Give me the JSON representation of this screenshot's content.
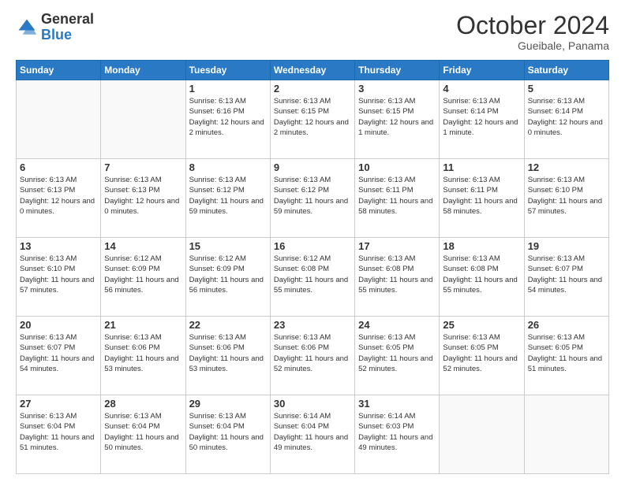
{
  "logo": {
    "general": "General",
    "blue": "Blue"
  },
  "header": {
    "month": "October 2024",
    "location": "Gueibale, Panama"
  },
  "weekdays": [
    "Sunday",
    "Monday",
    "Tuesday",
    "Wednesday",
    "Thursday",
    "Friday",
    "Saturday"
  ],
  "weeks": [
    [
      {
        "day": "",
        "info": ""
      },
      {
        "day": "",
        "info": ""
      },
      {
        "day": "1",
        "info": "Sunrise: 6:13 AM\nSunset: 6:16 PM\nDaylight: 12 hours and 2 minutes."
      },
      {
        "day": "2",
        "info": "Sunrise: 6:13 AM\nSunset: 6:15 PM\nDaylight: 12 hours and 2 minutes."
      },
      {
        "day": "3",
        "info": "Sunrise: 6:13 AM\nSunset: 6:15 PM\nDaylight: 12 hours and 1 minute."
      },
      {
        "day": "4",
        "info": "Sunrise: 6:13 AM\nSunset: 6:14 PM\nDaylight: 12 hours and 1 minute."
      },
      {
        "day": "5",
        "info": "Sunrise: 6:13 AM\nSunset: 6:14 PM\nDaylight: 12 hours and 0 minutes."
      }
    ],
    [
      {
        "day": "6",
        "info": "Sunrise: 6:13 AM\nSunset: 6:13 PM\nDaylight: 12 hours and 0 minutes."
      },
      {
        "day": "7",
        "info": "Sunrise: 6:13 AM\nSunset: 6:13 PM\nDaylight: 12 hours and 0 minutes."
      },
      {
        "day": "8",
        "info": "Sunrise: 6:13 AM\nSunset: 6:12 PM\nDaylight: 11 hours and 59 minutes."
      },
      {
        "day": "9",
        "info": "Sunrise: 6:13 AM\nSunset: 6:12 PM\nDaylight: 11 hours and 59 minutes."
      },
      {
        "day": "10",
        "info": "Sunrise: 6:13 AM\nSunset: 6:11 PM\nDaylight: 11 hours and 58 minutes."
      },
      {
        "day": "11",
        "info": "Sunrise: 6:13 AM\nSunset: 6:11 PM\nDaylight: 11 hours and 58 minutes."
      },
      {
        "day": "12",
        "info": "Sunrise: 6:13 AM\nSunset: 6:10 PM\nDaylight: 11 hours and 57 minutes."
      }
    ],
    [
      {
        "day": "13",
        "info": "Sunrise: 6:13 AM\nSunset: 6:10 PM\nDaylight: 11 hours and 57 minutes."
      },
      {
        "day": "14",
        "info": "Sunrise: 6:12 AM\nSunset: 6:09 PM\nDaylight: 11 hours and 56 minutes."
      },
      {
        "day": "15",
        "info": "Sunrise: 6:12 AM\nSunset: 6:09 PM\nDaylight: 11 hours and 56 minutes."
      },
      {
        "day": "16",
        "info": "Sunrise: 6:12 AM\nSunset: 6:08 PM\nDaylight: 11 hours and 55 minutes."
      },
      {
        "day": "17",
        "info": "Sunrise: 6:13 AM\nSunset: 6:08 PM\nDaylight: 11 hours and 55 minutes."
      },
      {
        "day": "18",
        "info": "Sunrise: 6:13 AM\nSunset: 6:08 PM\nDaylight: 11 hours and 55 minutes."
      },
      {
        "day": "19",
        "info": "Sunrise: 6:13 AM\nSunset: 6:07 PM\nDaylight: 11 hours and 54 minutes."
      }
    ],
    [
      {
        "day": "20",
        "info": "Sunrise: 6:13 AM\nSunset: 6:07 PM\nDaylight: 11 hours and 54 minutes."
      },
      {
        "day": "21",
        "info": "Sunrise: 6:13 AM\nSunset: 6:06 PM\nDaylight: 11 hours and 53 minutes."
      },
      {
        "day": "22",
        "info": "Sunrise: 6:13 AM\nSunset: 6:06 PM\nDaylight: 11 hours and 53 minutes."
      },
      {
        "day": "23",
        "info": "Sunrise: 6:13 AM\nSunset: 6:06 PM\nDaylight: 11 hours and 52 minutes."
      },
      {
        "day": "24",
        "info": "Sunrise: 6:13 AM\nSunset: 6:05 PM\nDaylight: 11 hours and 52 minutes."
      },
      {
        "day": "25",
        "info": "Sunrise: 6:13 AM\nSunset: 6:05 PM\nDaylight: 11 hours and 52 minutes."
      },
      {
        "day": "26",
        "info": "Sunrise: 6:13 AM\nSunset: 6:05 PM\nDaylight: 11 hours and 51 minutes."
      }
    ],
    [
      {
        "day": "27",
        "info": "Sunrise: 6:13 AM\nSunset: 6:04 PM\nDaylight: 11 hours and 51 minutes."
      },
      {
        "day": "28",
        "info": "Sunrise: 6:13 AM\nSunset: 6:04 PM\nDaylight: 11 hours and 50 minutes."
      },
      {
        "day": "29",
        "info": "Sunrise: 6:13 AM\nSunset: 6:04 PM\nDaylight: 11 hours and 50 minutes."
      },
      {
        "day": "30",
        "info": "Sunrise: 6:14 AM\nSunset: 6:04 PM\nDaylight: 11 hours and 49 minutes."
      },
      {
        "day": "31",
        "info": "Sunrise: 6:14 AM\nSunset: 6:03 PM\nDaylight: 11 hours and 49 minutes."
      },
      {
        "day": "",
        "info": ""
      },
      {
        "day": "",
        "info": ""
      }
    ]
  ]
}
